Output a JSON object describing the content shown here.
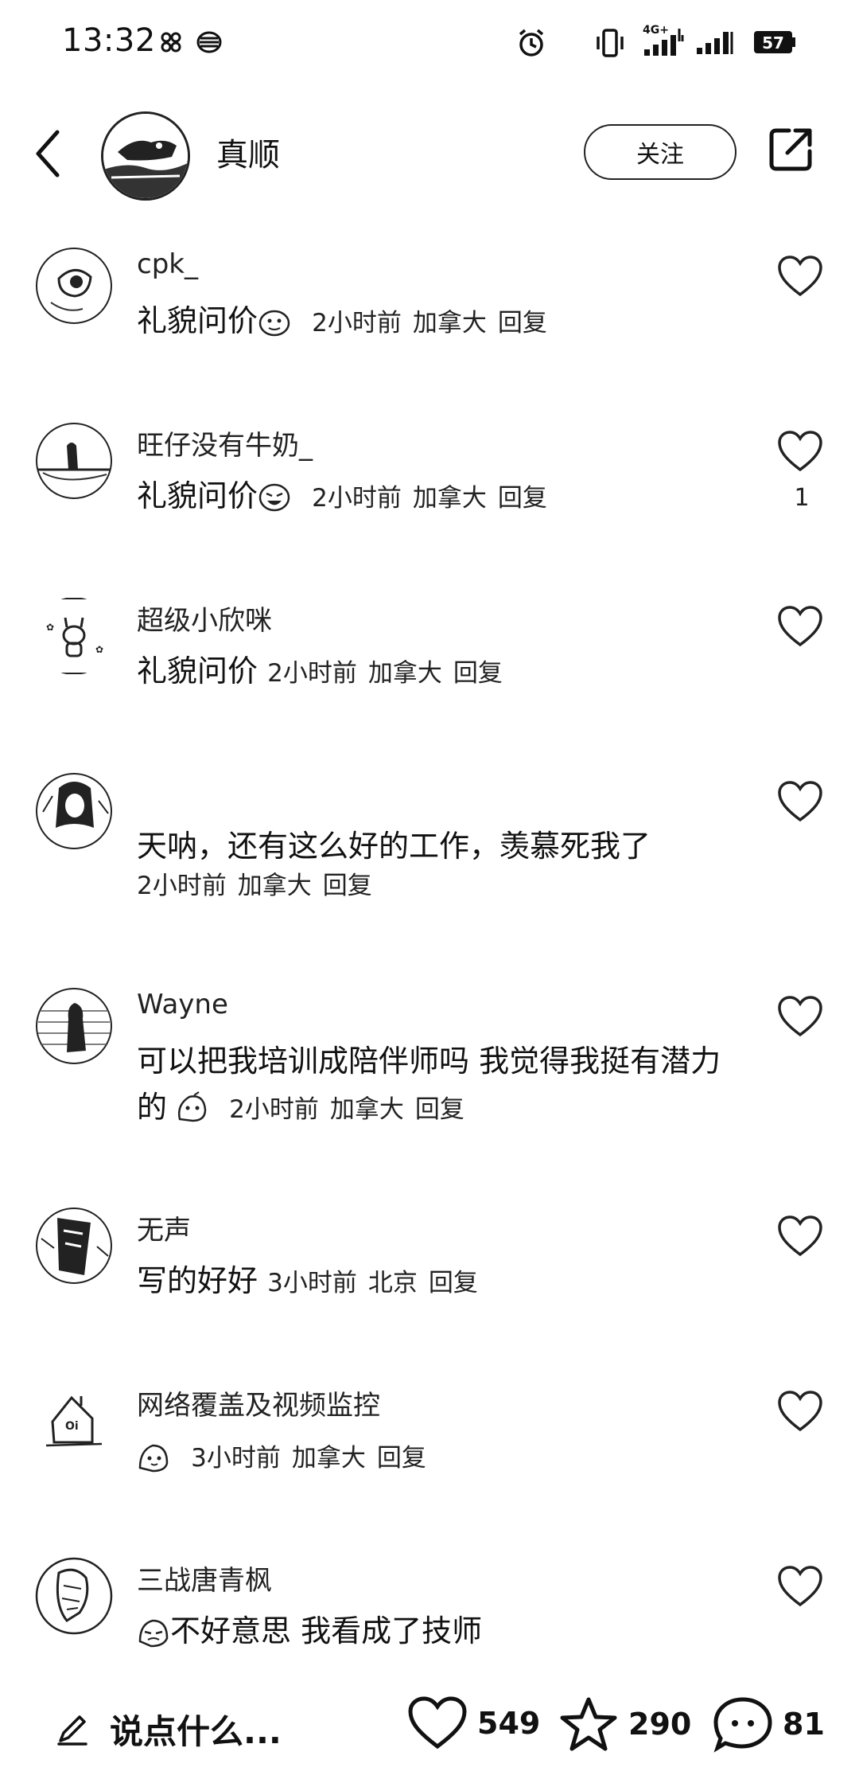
{
  "status_bar": {
    "time": "13:32",
    "network": "4G+",
    "battery": "57",
    "icons": [
      "pinwheel-icon",
      "app-icon",
      "alarm-icon",
      "vibrate-icon",
      "signal-icon",
      "signal-icon-2",
      "battery-icon"
    ]
  },
  "header": {
    "name": "真顺",
    "follow_label": "关注"
  },
  "comments": [
    {
      "name": "cpk_",
      "text": "礼貌问价",
      "emoji": true,
      "time": "2小时前",
      "location": "加拿大",
      "reply": "回复",
      "likes": ""
    },
    {
      "name": "旺仔没有牛奶_",
      "text": "礼貌问价",
      "emoji": true,
      "time": "2小时前",
      "location": "加拿大",
      "reply": "回复",
      "likes": "1"
    },
    {
      "name": "超级小欣咪",
      "text": "礼貌问价",
      "emoji": false,
      "time": "2小时前",
      "location": "加拿大",
      "reply": "回复",
      "likes": ""
    },
    {
      "name": "",
      "text": "天呐，还有这么好的工作，羡慕死我了",
      "emoji": false,
      "time": "2小时前",
      "location": "加拿大",
      "reply": "回复",
      "likes": ""
    },
    {
      "name": "Wayne",
      "text": "可以把我培训成陪伴师吗 我觉得我挺有潜力的",
      "emoji": true,
      "time": "2小时前",
      "location": "加拿大",
      "reply": "回复",
      "likes": ""
    },
    {
      "name": "无声",
      "text": "写的好好",
      "emoji": false,
      "time": "3小时前",
      "location": "北京",
      "reply": "回复",
      "likes": ""
    },
    {
      "name": "网络覆盖及视频监控",
      "text": "",
      "emoji": true,
      "time": "3小时前",
      "location": "加拿大",
      "reply": "回复",
      "likes": ""
    },
    {
      "name": "三战唐青枫",
      "text": "不好意思 我看成了技师",
      "emoji": true,
      "time": "",
      "location": "",
      "reply": "",
      "likes": ""
    }
  ],
  "bottom_bar": {
    "input_placeholder": "说点什么...",
    "likes": "549",
    "favorites": "290",
    "comments": "81"
  }
}
